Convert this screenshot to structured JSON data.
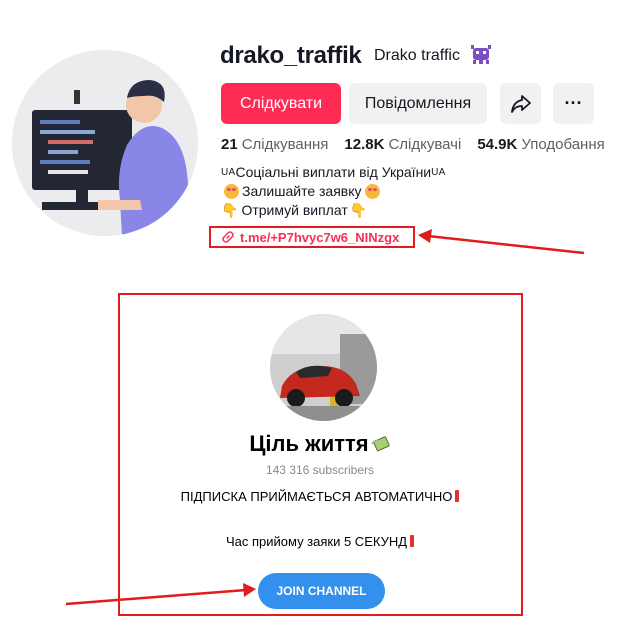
{
  "profile": {
    "username": "drako_traffik",
    "nickname": "Drako traffic",
    "nickname_emoji": "alien-monster-icon",
    "buttons": {
      "follow": "Слідкувати",
      "message": "Повідомлення",
      "share_icon": "share-arrow-icon",
      "more_icon": "more-dots-icon",
      "more_label": "···"
    },
    "stats": [
      {
        "value": "21",
        "label": "Слідкування"
      },
      {
        "value": "12.8K",
        "label": "Слідкувачі"
      },
      {
        "value": "54.9K",
        "label": "Уподобання"
      }
    ],
    "bio": {
      "line1_prefix": "UA",
      "line1_text": "Соціальні виплати від України",
      "line1_suffix": "UA",
      "line2_text": "Залишайте заявку",
      "line3_text": "Отримуй виплат"
    },
    "link": "t.me/+P7hvyc7w6_NINzgx"
  },
  "telegram_card": {
    "title": "Ціль життя",
    "subscribers": "143 316 subscribers",
    "description_line1": "ПІДПИСКА ПРИЙМАЄТЬСЯ АВТОМАТИЧНО",
    "description_line2": "Час прийому заяки 5 СЕКУНД",
    "join_label": "JOIN CHANNEL"
  },
  "colors": {
    "accent": "#fe2c55",
    "annotation_red": "#e21c1c",
    "telegram_blue": "#3390ec"
  }
}
